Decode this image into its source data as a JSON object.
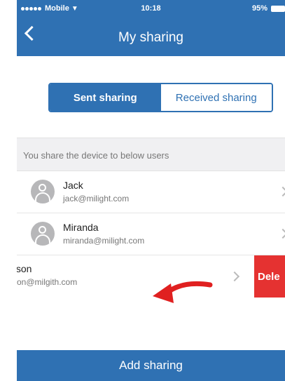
{
  "status_bar": {
    "carrier": "Mobile",
    "time": "10:18",
    "battery": "95%"
  },
  "nav": {
    "title": "My sharing"
  },
  "tabs": [
    {
      "label": "Sent sharing",
      "active": true
    },
    {
      "label": "Received sharing",
      "active": false
    }
  ],
  "section": {
    "header": "You share the device to below users"
  },
  "users": [
    {
      "name": "Jack",
      "email": "jack@milight.com"
    },
    {
      "name": "Miranda",
      "email": "miranda@milight.com"
    },
    {
      "name": "Pierson",
      "email": "pierson@milgith.com"
    }
  ],
  "delete_label": "Dele",
  "add_button": {
    "label": "Add sharing"
  },
  "colors": {
    "primary": "#2f71b3",
    "danger": "#e53231",
    "arrow": "#e02020"
  },
  "icons": [
    "wifi-icon",
    "battery-icon",
    "back-icon",
    "avatar-icon",
    "chevron-right-icon",
    "swipe-arrow-icon"
  ]
}
